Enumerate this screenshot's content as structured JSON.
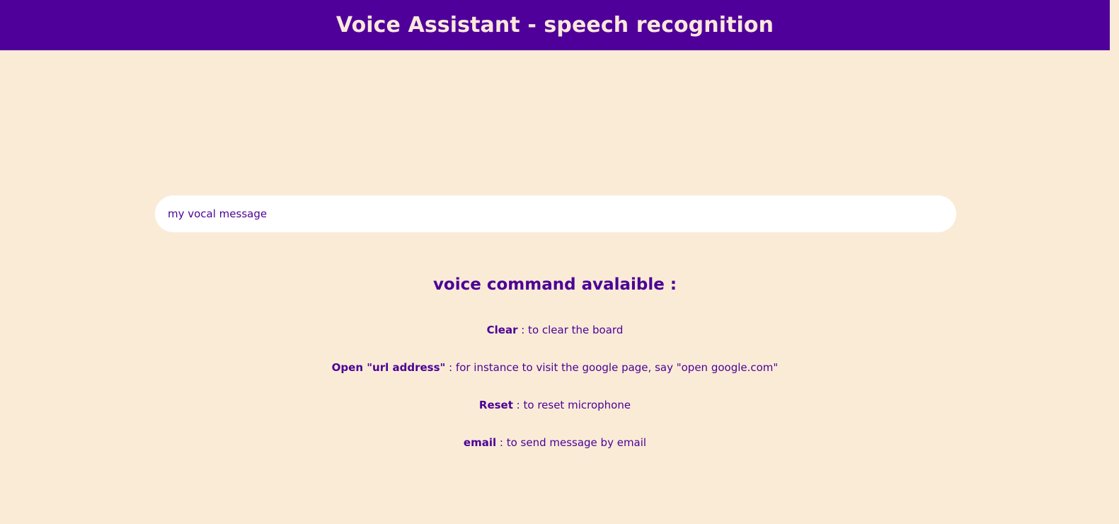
{
  "header": {
    "title": "Voice Assistant - speech recognition",
    "background_color": "#4f009b",
    "title_color": "#fbe8da"
  },
  "message": {
    "placeholder": "my vocal message",
    "value": ""
  },
  "commands": {
    "title": "voice command avalaible :",
    "items": [
      {
        "keyword": "Clear",
        "description": " : to clear the board"
      },
      {
        "keyword": "Open \"url address\"",
        "description": " : for instance to visit the google page, say \"open google.com\""
      },
      {
        "keyword": "Reset",
        "description": " : to reset microphone"
      },
      {
        "keyword": "email",
        "description": " : to send message by email"
      }
    ]
  },
  "colors": {
    "page_background": "#faebd7",
    "text": "#4b0096",
    "input_background": "#ffffff"
  }
}
